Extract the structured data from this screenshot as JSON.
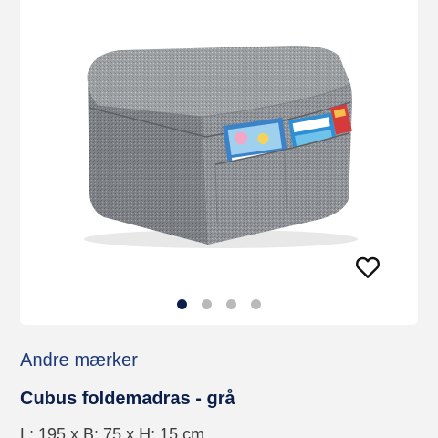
{
  "product": {
    "brand": "Andre mærker",
    "title": "Cubus foldemadras - grå",
    "dimensions": "L: 195 x B: 75 x H: 15 cm"
  },
  "gallery": {
    "image_count": 4,
    "active_index": 0
  },
  "icons": {
    "favorite": "heart-outline-icon"
  },
  "colors": {
    "accent": "#0b1f4a",
    "brand_link": "#1d3a78",
    "dot_inactive": "#b9b9b9",
    "background": "#f3f3f3",
    "card": "#ffffff",
    "fabric": "#8e9296"
  }
}
